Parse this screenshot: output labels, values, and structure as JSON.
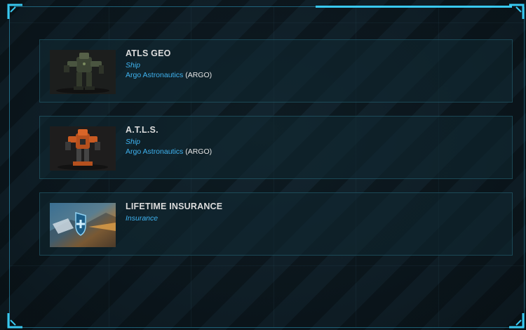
{
  "colors": {
    "accent": "#3fb3f0",
    "border": "#2a8fb0",
    "panel_bg": "#0d1a21",
    "title_text": "#dcdcdc"
  },
  "items": [
    {
      "title": "ATLS GEO",
      "type": "Ship",
      "manufacturer": "Argo Astronautics",
      "manufacturer_code": "(ARGO)",
      "image_icon": "mech-suit-image"
    },
    {
      "title": "A.T.L.S.",
      "type": "Ship",
      "manufacturer": "Argo Astronautics",
      "manufacturer_code": "(ARGO)",
      "image_icon": "mech-suit-image"
    },
    {
      "title": "LIFETIME INSURANCE",
      "type": "Insurance",
      "image_icon": "insurance-shield-image"
    }
  ]
}
